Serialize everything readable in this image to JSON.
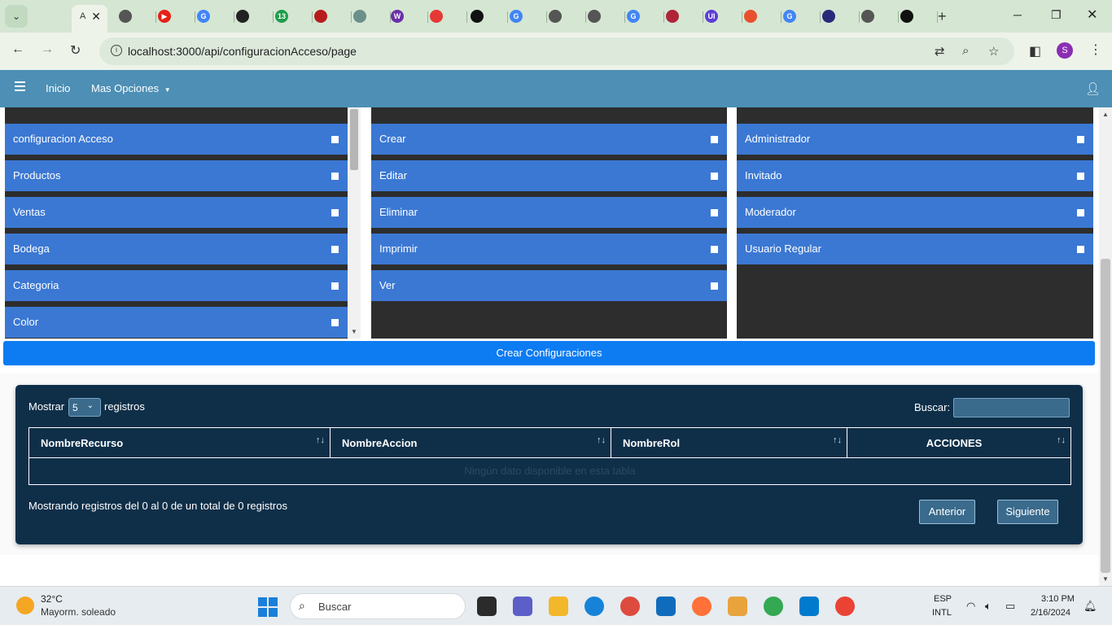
{
  "browser": {
    "active_tab_initial": "A",
    "tab_favicons": [
      {
        "name": "tab-favicon-globe",
        "color": "#555555",
        "letter": ""
      },
      {
        "name": "tab-favicon-youtube",
        "color": "#e62117",
        "letter": "▶"
      },
      {
        "name": "tab-favicon-google",
        "color": "#4285f4",
        "letter": "G"
      },
      {
        "name": "tab-favicon-dark",
        "color": "#222222",
        "letter": ""
      },
      {
        "name": "tab-favicon-green",
        "color": "#1e9e4a",
        "letter": "13"
      },
      {
        "name": "tab-favicon-red",
        "color": "#b71c1c",
        "letter": ""
      },
      {
        "name": "tab-favicon-chatgpt",
        "color": "#6b8f8a",
        "letter": ""
      },
      {
        "name": "tab-favicon-purple",
        "color": "#6a2fa8",
        "letter": "W"
      },
      {
        "name": "tab-favicon-red2",
        "color": "#e53935",
        "letter": ""
      },
      {
        "name": "tab-favicon-black",
        "color": "#111111",
        "letter": ""
      },
      {
        "name": "tab-favicon-google2",
        "color": "#4285f4",
        "letter": "G"
      },
      {
        "name": "tab-favicon-globe2",
        "color": "#555555",
        "letter": ""
      },
      {
        "name": "tab-favicon-globe3",
        "color": "#555555",
        "letter": ""
      },
      {
        "name": "tab-favicon-google3",
        "color": "#4285f4",
        "letter": "G"
      },
      {
        "name": "tab-favicon-maroon",
        "color": "#b0243a",
        "letter": ""
      },
      {
        "name": "tab-favicon-ui",
        "color": "#5b3fd6",
        "letter": "UI"
      },
      {
        "name": "tab-favicon-git",
        "color": "#e8502d",
        "letter": ""
      },
      {
        "name": "tab-favicon-google4",
        "color": "#4285f4",
        "letter": "G"
      },
      {
        "name": "tab-favicon-navy",
        "color": "#2a2a7a",
        "letter": ""
      },
      {
        "name": "tab-favicon-globe4",
        "color": "#555555",
        "letter": ""
      },
      {
        "name": "tab-favicon-github",
        "color": "#111111",
        "letter": ""
      }
    ],
    "url": "localhost:3000/api/configuracionAcceso/page",
    "profile_initial": "S"
  },
  "navbar": {
    "home": "Inicio",
    "more": "Mas Opciones"
  },
  "recursos": [
    {
      "label": "configuracion Acceso"
    },
    {
      "label": "Productos"
    },
    {
      "label": "Ventas"
    },
    {
      "label": "Bodega"
    },
    {
      "label": "Categoria"
    },
    {
      "label": "Color"
    }
  ],
  "acciones": [
    {
      "label": "Crear"
    },
    {
      "label": "Editar"
    },
    {
      "label": "Eliminar"
    },
    {
      "label": "Imprimir"
    },
    {
      "label": "Ver"
    }
  ],
  "roles": [
    {
      "label": "Administrador"
    },
    {
      "label": "Invitado"
    },
    {
      "label": "Moderador"
    },
    {
      "label": "Usuario Regular"
    }
  ],
  "crear_button": "Crear Configuraciones",
  "datatable": {
    "show_label": "Mostrar",
    "length_value": "5",
    "records_label": "registros",
    "search_label": "Buscar:",
    "columns": [
      "NombreRecurso",
      "NombreAccion",
      "NombreRol",
      "ACCIONES"
    ],
    "empty_message": "Ningún dato disponible en esta tabla",
    "info": "Mostrando registros del 0 al 0 de un total de 0 registros",
    "prev": "Anterior",
    "next": "Siguiente"
  },
  "taskbar": {
    "temperature": "32°C",
    "weather": "Mayorm. soleado",
    "search_placeholder": "Buscar",
    "lang_top": "ESP",
    "lang_bottom": "INTL",
    "time": "3:10 PM",
    "date": "2/16/2024"
  },
  "colors": {
    "navbar": "#4d8fb5",
    "item_row": "#3b78d3",
    "panel_bg": "#2d2d2d",
    "primary_button": "#0d7cf2",
    "table_bg": "#0f2f49"
  }
}
